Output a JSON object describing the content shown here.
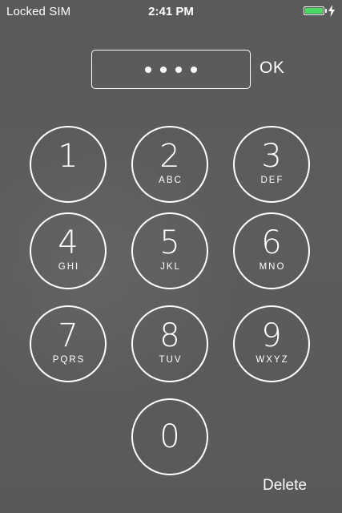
{
  "status_bar": {
    "carrier": "Locked SIM",
    "time": "2:41 PM",
    "battery_level": 1.0,
    "battery_color": "#4cd964",
    "charging_icon": "lightning-bolt-icon"
  },
  "passcode": {
    "entered_digits_count": 4,
    "ok_label": "OK"
  },
  "keypad": {
    "keys": [
      {
        "digit": "1",
        "letters": ""
      },
      {
        "digit": "2",
        "letters": "ABC"
      },
      {
        "digit": "3",
        "letters": "DEF"
      },
      {
        "digit": "4",
        "letters": "GHI"
      },
      {
        "digit": "5",
        "letters": "JKL"
      },
      {
        "digit": "6",
        "letters": "MNO"
      },
      {
        "digit": "7",
        "letters": "PQRS"
      },
      {
        "digit": "8",
        "letters": "TUV"
      },
      {
        "digit": "9",
        "letters": "WXYZ"
      },
      {
        "digit": "0",
        "letters": ""
      }
    ],
    "delete_label": "Delete"
  },
  "colors": {
    "background": "#5c5c5c",
    "foreground": "#ffffff"
  }
}
